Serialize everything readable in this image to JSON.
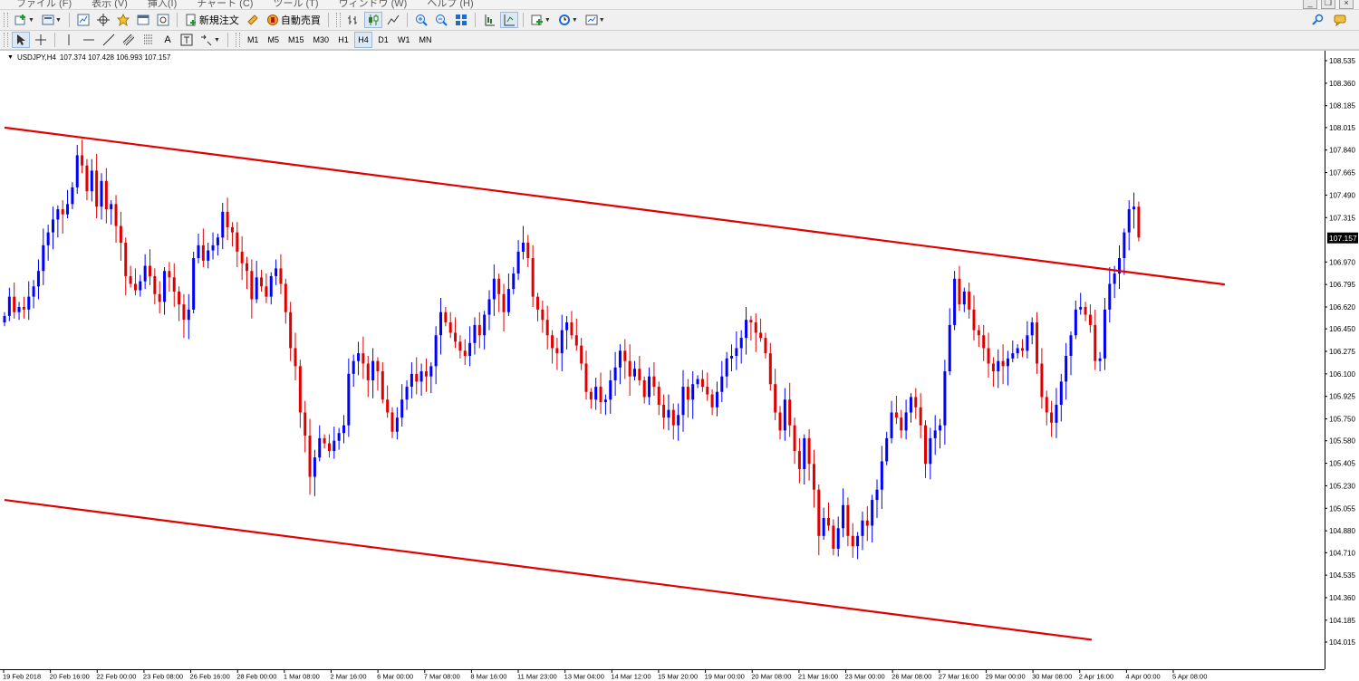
{
  "menu": {
    "items": [
      "ファイル (F)",
      "表示 (V)",
      "挿入(I)",
      "チャート (C)",
      "ツール (T)",
      "ウィンドウ (W)",
      "ヘルプ (H)"
    ],
    "window_buttons": [
      "_",
      "❐",
      "×"
    ]
  },
  "toolbar1": {
    "new_order_label": "新規注文",
    "auto_trade_label": "自動売買"
  },
  "toolbar2": {
    "timeframes": [
      "M1",
      "M5",
      "M15",
      "M30",
      "H1",
      "H4",
      "D1",
      "W1",
      "MN"
    ],
    "active_timeframe": "H4",
    "text_tool": "A"
  },
  "chart": {
    "symbol_info": "USDJPY,H4",
    "ohlc": "107.374 107.428 106.993 107.157",
    "current_price": "107.157",
    "colors": {
      "bull": "#0000ff",
      "bear": "#e00000",
      "trendline": "#e00000",
      "axis": "#000000",
      "background": "#ffffff"
    }
  },
  "chart_data": {
    "type": "candlestick",
    "symbol": "USDJPY",
    "timeframe": "H4",
    "ylim": [
      104.015,
      108.535
    ],
    "y_ticks": [
      "108.535",
      "108.360",
      "108.185",
      "108.015",
      "107.840",
      "107.665",
      "107.490",
      "107.315",
      "107.157",
      "106.970",
      "106.795",
      "106.620",
      "106.450",
      "106.275",
      "106.100",
      "105.925",
      "105.750",
      "105.580",
      "105.405",
      "105.230",
      "105.055",
      "104.880",
      "104.710",
      "104.535",
      "104.360",
      "104.185",
      "104.015"
    ],
    "x_ticks": [
      "19 Feb 2018",
      "20 Feb 16:00",
      "22 Feb 00:00",
      "23 Feb 08:00",
      "26 Feb 16:00",
      "28 Feb 00:00",
      "1 Mar 08:00",
      "2 Mar 16:00",
      "6 Mar 00:00",
      "7 Mar 08:00",
      "8 Mar 16:00",
      "11 Mar 23:00",
      "13 Mar 04:00",
      "14 Mar 12:00",
      "15 Mar 20:00",
      "19 Mar 00:00",
      "20 Mar 08:00",
      "21 Mar 16:00",
      "23 Mar 00:00",
      "26 Mar 08:00",
      "27 Mar 16:00",
      "29 Mar 00:00",
      "30 Mar 08:00",
      "2 Apr 16:00",
      "4 Apr 00:00",
      "5 Apr 08:00"
    ],
    "closes": [
      106.55,
      106.7,
      106.58,
      106.62,
      106.6,
      106.7,
      106.78,
      106.9,
      107.1,
      107.2,
      107.3,
      107.38,
      107.34,
      107.42,
      107.55,
      107.8,
      107.72,
      107.52,
      107.68,
      107.4,
      107.6,
      107.38,
      107.42,
      107.25,
      107.12,
      106.86,
      106.8,
      106.75,
      106.82,
      106.94,
      106.86,
      106.72,
      106.66,
      106.9,
      106.85,
      106.74,
      106.64,
      106.52,
      106.6,
      107.0,
      107.1,
      106.98,
      107.06,
      107.1,
      107.16,
      107.36,
      107.24,
      107.2,
      107.05,
      106.96,
      106.9,
      106.68,
      106.85,
      106.78,
      106.7,
      106.86,
      106.92,
      106.8,
      106.58,
      106.3,
      106.16,
      105.8,
      105.62,
      105.3,
      105.45,
      105.6,
      105.56,
      105.5,
      105.58,
      105.64,
      105.7,
      106.1,
      106.2,
      106.26,
      106.18,
      106.05,
      106.2,
      106.12,
      105.9,
      105.8,
      105.65,
      105.76,
      105.9,
      106.0,
      106.1,
      106.04,
      106.12,
      106.08,
      106.16,
      106.4,
      106.58,
      106.5,
      106.42,
      106.35,
      106.28,
      106.24,
      106.34,
      106.48,
      106.4,
      106.56,
      106.68,
      106.84,
      106.72,
      106.58,
      106.76,
      106.88,
      107.05,
      107.12,
      107.0,
      106.7,
      106.6,
      106.52,
      106.4,
      106.3,
      106.26,
      106.44,
      106.5,
      106.4,
      106.32,
      106.18,
      105.96,
      105.9,
      106.0,
      105.88,
      105.9,
      106.05,
      106.15,
      106.28,
      106.2,
      106.08,
      106.14,
      106.05,
      105.92,
      106.08,
      106.0,
      105.86,
      105.76,
      105.82,
      105.7,
      105.78,
      106.0,
      105.9,
      106.02,
      106.06,
      106.0,
      105.94,
      105.84,
      105.96,
      106.08,
      106.22,
      106.24,
      106.3,
      106.38,
      106.52,
      106.5,
      106.42,
      106.38,
      106.26,
      106.02,
      105.8,
      105.66,
      105.9,
      105.7,
      105.5,
      105.36,
      105.6,
      105.4,
      105.2,
      104.84,
      104.98,
      104.92,
      104.74,
      104.9,
      105.08,
      104.84,
      104.76,
      104.84,
      104.96,
      104.92,
      105.12,
      105.2,
      105.42,
      105.6,
      105.8,
      105.76,
      105.66,
      105.8,
      105.92,
      105.84,
      105.7,
      105.4,
      105.6,
      105.66,
      105.7,
      106.12,
      106.48,
      106.84,
      106.64,
      106.74,
      106.6,
      106.44,
      106.4,
      106.3,
      106.18,
      106.12,
      106.2,
      106.16,
      106.22,
      106.26,
      106.3,
      106.28,
      106.4,
      106.5,
      106.18,
      105.92,
      105.8,
      105.72,
      105.86,
      106.04,
      106.24,
      106.4,
      106.6,
      106.62,
      106.56,
      106.48,
      106.2,
      106.22,
      106.6,
      106.8,
      106.88,
      107.0,
      107.2,
      107.38,
      107.4,
      107.16
    ]
  }
}
